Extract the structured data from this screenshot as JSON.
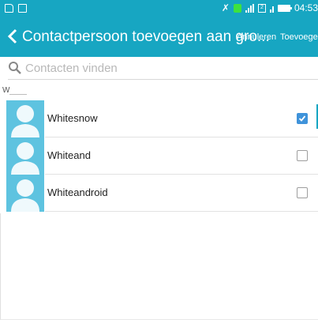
{
  "status_bar": {
    "time": "04:53"
  },
  "header": {
    "title": "Contactpersoon toevoegen aan gro...",
    "cancel_label": "Annuleren",
    "add_label": "Toevoegen"
  },
  "search": {
    "placeholder": "Contacten vinden",
    "value": ""
  },
  "section_header": "W",
  "contacts": [
    {
      "name": "Whitesnow",
      "selected": true
    },
    {
      "name": "Whiteand",
      "selected": false
    },
    {
      "name": "Whiteandroid",
      "selected": false
    }
  ],
  "colors": {
    "accent": "#17a6c2",
    "checkbox_on": "#3f93da",
    "avatar_bg": "#5ec3e0"
  }
}
